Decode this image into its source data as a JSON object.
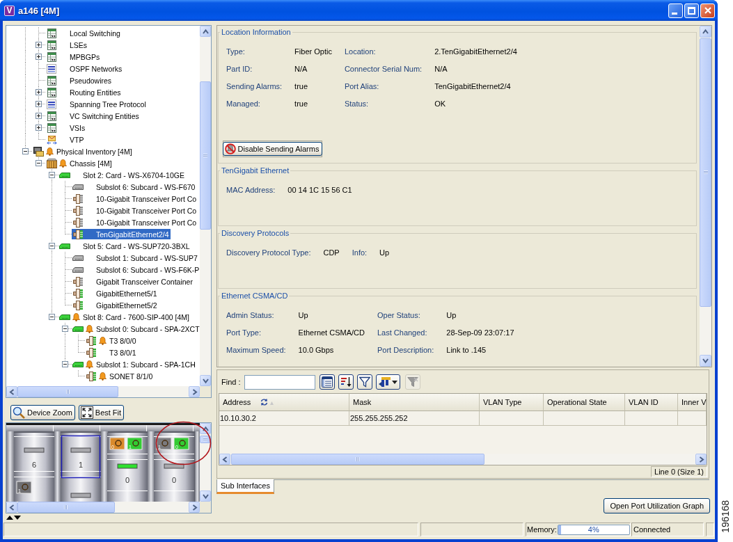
{
  "window": {
    "logo": "V",
    "title": "a146 [4M]"
  },
  "tree": {
    "items": [
      {
        "children": [
          {
            "label": "Local Switching",
            "kind": "table",
            "alarm": false,
            "selected": false
          },
          {
            "label": "LSEs",
            "kind": "table",
            "expanded": false,
            "alarm": false,
            "selected": false
          },
          {
            "label": "MPBGPs",
            "kind": "table",
            "expanded": false,
            "alarm": false,
            "selected": false
          },
          {
            "label": "OSPF Networks",
            "kind": "grid",
            "alarm": false,
            "selected": false
          },
          {
            "label": "Pseudowires",
            "kind": "table",
            "alarm": false,
            "selected": false
          },
          {
            "label": "Routing Entities",
            "kind": "table",
            "expanded": false,
            "alarm": false,
            "selected": false
          },
          {
            "label": "Spanning Tree Protocol",
            "kind": "grid",
            "expanded": false,
            "alarm": false,
            "selected": false
          },
          {
            "label": "VC Switching Entities",
            "kind": "table",
            "expanded": false,
            "alarm": false,
            "selected": false
          },
          {
            "label": "VSIs",
            "kind": "table",
            "expanded": false,
            "alarm": false,
            "selected": false
          },
          {
            "label": "VTP",
            "kind": "envelope",
            "alarm": false,
            "selected": false
          }
        ]
      },
      {
        "label": "Physical Inventory [4M]",
        "kind": "inventory",
        "expanded": true,
        "alarm": true,
        "selected": false,
        "children": [
          {
            "label": "Chassis [4M]",
            "kind": "chassis",
            "expanded": true,
            "alarm": true,
            "selected": false,
            "children": [
              {
                "label": "Slot 2: Card - WS-X6704-10GE",
                "kind": "card",
                "expanded": true,
                "alarm": false,
                "selected": false,
                "children": [
                  {
                    "label": "Subslot 6: Subcard - WS-F670",
                    "kind": "subcard",
                    "alarm": false,
                    "selected": false
                  },
                  {
                    "label": "10-Gigabit Transceiver Port Co",
                    "kind": "port",
                    "alarm": false,
                    "selected": false
                  },
                  {
                    "label": "10-Gigabit Transceiver Port Co",
                    "kind": "port",
                    "alarm": false,
                    "selected": false
                  },
                  {
                    "label": "10-Gigabit Transceiver Port Co",
                    "kind": "port",
                    "alarm": false,
                    "selected": false
                  },
                  {
                    "label": "TenGigabitEthernet2/4",
                    "kind": "liveport",
                    "alarm": false,
                    "selected": true
                  }
                ]
              },
              {
                "label": "Slot 5: Card - WS-SUP720-3BXL",
                "kind": "card",
                "expanded": true,
                "alarm": false,
                "selected": false,
                "children": [
                  {
                    "label": "Subslot 1: Subcard - WS-SUP7",
                    "kind": "subcard",
                    "alarm": false,
                    "selected": false
                  },
                  {
                    "label": "Subslot 6: Subcard - WS-F6K-P",
                    "kind": "subcard",
                    "alarm": false,
                    "selected": false
                  },
                  {
                    "label": "Gigabit Transceiver Container",
                    "kind": "port",
                    "alarm": false,
                    "selected": false
                  },
                  {
                    "label": "GigabitEthernet5/1",
                    "kind": "liveport",
                    "alarm": false,
                    "selected": false
                  },
                  {
                    "label": "GigabitEthernet5/2",
                    "kind": "liveport",
                    "alarm": false,
                    "selected": false
                  }
                ]
              },
              {
                "label": "Slot 8: Card - 7600-SIP-400 [4M]",
                "kind": "card",
                "expanded": true,
                "alarm": true,
                "selected": false,
                "children": [
                  {
                    "label": "Subslot 0: Subcard - SPA-2XCT",
                    "kind": "card",
                    "expanded": true,
                    "alarm": true,
                    "selected": false,
                    "children": [
                      {
                        "label": "T3 8/0/0",
                        "kind": "liveport",
                        "alarm": true,
                        "selected": false
                      },
                      {
                        "label": "T3 8/0/1",
                        "kind": "liveport",
                        "alarm": false,
                        "selected": false
                      }
                    ]
                  },
                  {
                    "label": "Subslot 1: Subcard - SPA-1CH",
                    "kind": "card",
                    "expanded": true,
                    "alarm": true,
                    "selected": false,
                    "children": [
                      {
                        "label": "SONET 8/1/0",
                        "kind": "liveport",
                        "alarm": true,
                        "selected": false
                      }
                    ]
                  }
                ]
              }
            ]
          }
        ]
      }
    ]
  },
  "device_view": {
    "buttons": [
      {
        "label": "Device Zoom",
        "kind": "zoom"
      },
      {
        "label": "Best Fit",
        "kind": "fit"
      }
    ],
    "slots": [
      {
        "label": "6",
        "kind": "blank",
        "selected": false,
        "highlighted": false,
        "ports": [
          {
            "label": "1",
            "color": "#6e6e72"
          }
        ]
      },
      {
        "label": "1",
        "kind": "blank",
        "selected": true,
        "highlighted": false
      },
      {
        "label": "0",
        "kind": "ported",
        "selected": false,
        "highlighted": false,
        "led": true,
        "ports": [
          {
            "label": "0",
            "color": "#d98a2b"
          },
          {
            "label": "1",
            "color": "#33cc33"
          }
        ]
      },
      {
        "label": "0",
        "kind": "ported",
        "selected": false,
        "highlighted": true,
        "led": false,
        "ports": [
          {
            "label": "1",
            "color": "#7a7a7e"
          },
          {
            "label": "0",
            "color": "#33cc33"
          }
        ]
      }
    ]
  },
  "details": {
    "groups": [
      {
        "title": "Location Information",
        "fields": [
          {
            "label": "Type:",
            "value": "Fiber Optic"
          },
          {
            "label": "Location:",
            "value": "2.TenGigabitEthernet2/4"
          },
          {
            "label": "Part ID:",
            "value": "N/A"
          },
          {
            "label": "Connector Serial Num:",
            "value": "N/A"
          },
          {
            "label": "Sending Alarms:",
            "value": "true"
          },
          {
            "label": "Port Alias:",
            "value": "TenGigabitEthernet2/4"
          },
          {
            "label": "Managed:",
            "value": "true"
          },
          {
            "label": "Status:",
            "value": "OK"
          }
        ],
        "button": {
          "label": "Disable Sending Alarms"
        }
      },
      {
        "title": "TenGigabit Ethernet",
        "fields": [
          {
            "label": "MAC Address:",
            "value": "00 14 1C 15 56 C1"
          }
        ]
      },
      {
        "title": "Discovery Protocols",
        "fields": [
          {
            "label": "Discovery Protocol Type:",
            "value": "CDP"
          },
          {
            "label": "Info:",
            "value": "Up"
          }
        ]
      },
      {
        "title": "Ethernet CSMA/CD",
        "fields": [
          {
            "label": "Admin Status:",
            "value": "Up"
          },
          {
            "label": "Oper Status:",
            "value": "Up"
          },
          {
            "label": "Port Type:",
            "value": "Ethernet CSMA/CD"
          },
          {
            "label": "Last Changed:",
            "value": "28-Sep-09 23:07:17"
          },
          {
            "label": "Maximum Speed:",
            "value": "10.0 Gbps"
          },
          {
            "label": "Port Description:",
            "value": "Link to .145"
          }
        ]
      }
    ]
  },
  "table": {
    "find": {
      "label": "Find :"
    },
    "tools": [
      {
        "kind": "list",
        "disabled": false
      },
      {
        "kind": "sort",
        "disabled": false
      },
      {
        "kind": "filter",
        "disabled": false
      },
      {
        "kind": "columns",
        "disabled": false
      },
      {
        "kind": "clear",
        "disabled": true
      }
    ],
    "columns": [
      {
        "label": "Address",
        "sorted": true
      },
      {
        "label": "Mask",
        "sorted": false
      },
      {
        "label": "VLAN Type",
        "sorted": false
      },
      {
        "label": "Operational State",
        "sorted": false
      },
      {
        "label": "VLAN ID",
        "sorted": false
      },
      {
        "label": "Inner V",
        "sorted": false
      }
    ],
    "rows": [
      {
        "cells": [
          "10.10.30.2",
          "255.255.255.252"
        ]
      }
    ],
    "footer": "Line 0 (Size 1)"
  },
  "tabs": [
    {
      "label": "Sub Interfaces",
      "selected": true
    }
  ],
  "graph_button": {
    "label": "Open Port Utilization Graph"
  },
  "status_bar": {
    "memory": {
      "label": "Memory:",
      "level": 0.04,
      "reading": "4%"
    },
    "connection": "Connected"
  },
  "figure_number": "196168"
}
